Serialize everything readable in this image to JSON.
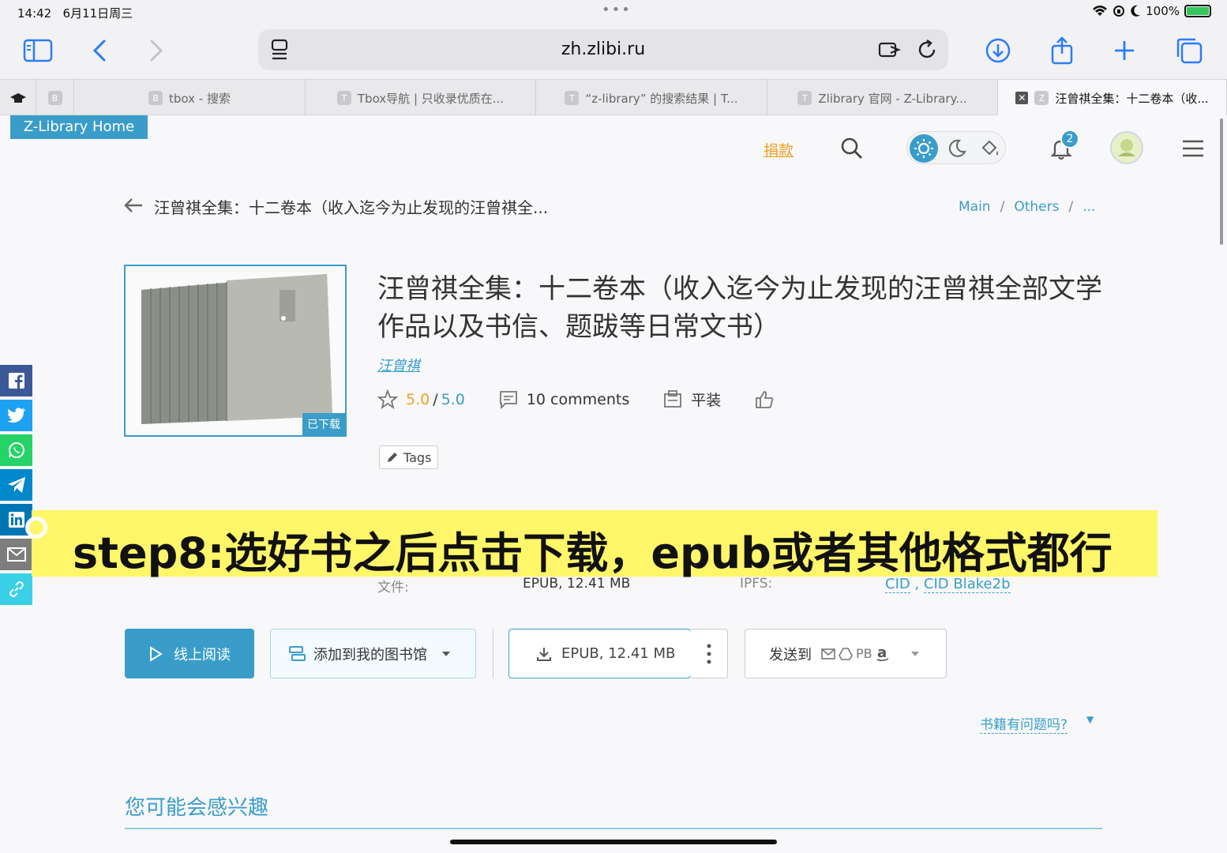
{
  "status_bar": {
    "time": "14:42",
    "date": "6月11日周三",
    "battery": "100%"
  },
  "browser": {
    "url": "zh.zlibi.ru",
    "tabs": [
      {
        "fav": "",
        "label": ""
      },
      {
        "fav": "B",
        "label": ""
      },
      {
        "fav": "B",
        "label": "tbox - 搜索"
      },
      {
        "fav": "T",
        "label": "Tbox导航 | 只收录优质在..."
      },
      {
        "fav": "T",
        "label": "“z-library” 的搜索结果 | T..."
      },
      {
        "fav": "T",
        "label": "Zlibrary 官网 - Z-Library..."
      },
      {
        "fav": "Z",
        "label": "汪曾祺全集：十二卷本（收...",
        "active": true
      }
    ]
  },
  "site": {
    "home_badge": "Z-Library Home",
    "donate": "捐款",
    "notification_count": "2"
  },
  "breadcrumb": {
    "back_title": "汪曾祺全集：十二卷本（收入迄今为止发现的汪曾祺全...",
    "items": [
      "Main",
      "Others",
      "..."
    ]
  },
  "book": {
    "title": "汪曾祺全集：十二卷本（收入迄今为止发现的汪曾祺全部文学作品以及书信、题跋等日常文书）",
    "author": "汪曾祺",
    "downloaded_badge": "已下载",
    "rating": "5.0",
    "rating_max": "5.0",
    "comments": "10 comments",
    "binding": "平装",
    "tags_label": "Tags",
    "file_label": "文件:",
    "file_value": "EPUB, 12.41 MB",
    "ipfs_label": "IPFS:",
    "ipfs_cid": "CID",
    "ipfs_blake": "CID Blake2b"
  },
  "actions": {
    "read_online": "线上阅读",
    "add_library": "添加到我的图书馆",
    "download": "EPUB, 12.41 MB",
    "send_to": "发送到",
    "send_services": "PB"
  },
  "problem_link": "书籍有问题吗?",
  "interest_heading": "您可能会感兴趣",
  "caption": "step8:选好书之后点击下载，epub或者其他格式都行"
}
